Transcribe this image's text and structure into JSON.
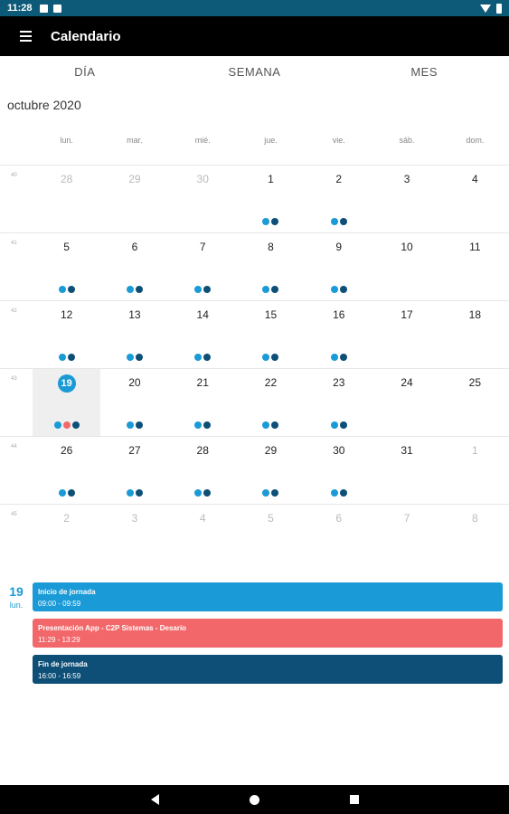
{
  "status": {
    "time": "11:28"
  },
  "app": {
    "title": "Calendario"
  },
  "tabs": [
    "DÍA",
    "SEMANA",
    "MES"
  ],
  "month_label": "octubre 2020",
  "weekdays": [
    "lun.",
    "mar.",
    "mié.",
    "jue.",
    "vie.",
    "sáb.",
    "dom."
  ],
  "colors": {
    "blue": "#1a9ad6",
    "navy": "#0d4f77",
    "red": "#f2686a"
  },
  "weeks": [
    {
      "weeknum": "40",
      "days": [
        {
          "d": "28",
          "muted": true,
          "dots": []
        },
        {
          "d": "29",
          "muted": true,
          "dots": []
        },
        {
          "d": "30",
          "muted": true,
          "dots": []
        },
        {
          "d": "1",
          "dots": [
            "blue",
            "navy"
          ]
        },
        {
          "d": "2",
          "dots": [
            "blue",
            "navy"
          ]
        },
        {
          "d": "3",
          "dots": []
        },
        {
          "d": "4",
          "dots": []
        }
      ]
    },
    {
      "weeknum": "41",
      "days": [
        {
          "d": "5",
          "dots": [
            "blue",
            "navy"
          ]
        },
        {
          "d": "6",
          "dots": [
            "blue",
            "navy"
          ]
        },
        {
          "d": "7",
          "dots": [
            "blue",
            "navy"
          ]
        },
        {
          "d": "8",
          "dots": [
            "blue",
            "navy"
          ]
        },
        {
          "d": "9",
          "dots": [
            "blue",
            "navy"
          ]
        },
        {
          "d": "10",
          "dots": []
        },
        {
          "d": "11",
          "dots": []
        }
      ]
    },
    {
      "weeknum": "42",
      "days": [
        {
          "d": "12",
          "dots": [
            "blue",
            "navy"
          ]
        },
        {
          "d": "13",
          "dots": [
            "blue",
            "navy"
          ]
        },
        {
          "d": "14",
          "dots": [
            "blue",
            "navy"
          ]
        },
        {
          "d": "15",
          "dots": [
            "blue",
            "navy"
          ]
        },
        {
          "d": "16",
          "dots": [
            "blue",
            "navy"
          ]
        },
        {
          "d": "17",
          "dots": []
        },
        {
          "d": "18",
          "dots": []
        }
      ]
    },
    {
      "weeknum": "43",
      "days": [
        {
          "d": "19",
          "today": true,
          "dots": [
            "blue",
            "red",
            "navy"
          ]
        },
        {
          "d": "20",
          "dots": [
            "blue",
            "navy"
          ]
        },
        {
          "d": "21",
          "dots": [
            "blue",
            "navy"
          ]
        },
        {
          "d": "22",
          "dots": [
            "blue",
            "navy"
          ]
        },
        {
          "d": "23",
          "dots": [
            "blue",
            "navy"
          ]
        },
        {
          "d": "24",
          "dots": []
        },
        {
          "d": "25",
          "dots": []
        }
      ]
    },
    {
      "weeknum": "44",
      "days": [
        {
          "d": "26",
          "dots": [
            "blue",
            "navy"
          ]
        },
        {
          "d": "27",
          "dots": [
            "blue",
            "navy"
          ]
        },
        {
          "d": "28",
          "dots": [
            "blue",
            "navy"
          ]
        },
        {
          "d": "29",
          "dots": [
            "blue",
            "navy"
          ]
        },
        {
          "d": "30",
          "dots": [
            "blue",
            "navy"
          ]
        },
        {
          "d": "31",
          "dots": []
        },
        {
          "d": "1",
          "muted": true,
          "dots": []
        }
      ]
    },
    {
      "weeknum": "45",
      "days": [
        {
          "d": "2",
          "muted": true,
          "dots": []
        },
        {
          "d": "3",
          "muted": true,
          "dots": []
        },
        {
          "d": "4",
          "muted": true,
          "dots": []
        },
        {
          "d": "5",
          "muted": true,
          "dots": []
        },
        {
          "d": "6",
          "muted": true,
          "dots": []
        },
        {
          "d": "7",
          "muted": true,
          "dots": []
        },
        {
          "d": "8",
          "muted": true,
          "dots": []
        }
      ]
    }
  ],
  "agenda": {
    "day_number": "19",
    "day_name": "lun.",
    "events": [
      {
        "title": "Inicio de jornada",
        "time": "09:00 - 09:59",
        "color": "blue"
      },
      {
        "title": "Presentación App - C2P Sistemas - Desarío",
        "time": "11:29 - 13:29",
        "color": "red"
      },
      {
        "title": "Fin de jornada",
        "time": "16:00 - 16:59",
        "color": "navy"
      }
    ]
  }
}
